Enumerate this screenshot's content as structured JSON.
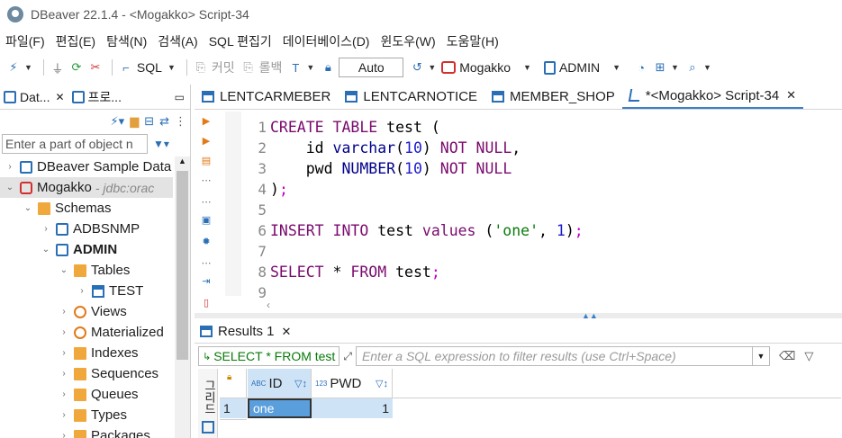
{
  "window": {
    "title": "DBeaver 22.1.4 - <Mogakko> Script-34"
  },
  "menu": [
    "파일(F)",
    "편집(E)",
    "탐색(N)",
    "검색(A)",
    "SQL 편집기",
    "데이터베이스(D)",
    "윈도우(W)",
    "도움말(H)"
  ],
  "toolbar": {
    "sql_label": "SQL",
    "commit_label": "커밋",
    "rollback_label": "롤백",
    "transaction_mode": "Auto",
    "datasource": "Mogakko",
    "schema": "ADMIN"
  },
  "navigator": {
    "tabs": [
      {
        "label": "Dat..."
      },
      {
        "label": "프로..."
      }
    ],
    "filter_placeholder": "Enter a part of object n",
    "tree": [
      {
        "label": "DBeaver Sample Data",
        "desc": "",
        "icon": "database-icon",
        "arrow": "›",
        "indent": 0
      },
      {
        "label": "Mogakko",
        "desc": "- jdbc:orac",
        "icon": "oracle-icon",
        "arrow": "⌄",
        "indent": 0,
        "selected": true
      },
      {
        "label": "Schemas",
        "desc": "",
        "icon": "folder-icon",
        "arrow": "⌄",
        "indent": 1
      },
      {
        "label": "ADBSNMP",
        "desc": "",
        "icon": "schema-icon",
        "arrow": "›",
        "indent": 2
      },
      {
        "label": "ADMIN",
        "desc": "",
        "icon": "schema-icon",
        "arrow": "⌄",
        "indent": 2,
        "bold": true
      },
      {
        "label": "Tables",
        "desc": "",
        "icon": "folder-icon",
        "arrow": "⌄",
        "indent": 3
      },
      {
        "label": "TEST",
        "desc": "",
        "icon": "table-icon",
        "arrow": "›",
        "indent": 4
      },
      {
        "label": "Views",
        "desc": "",
        "icon": "view-icon",
        "arrow": "›",
        "indent": 3
      },
      {
        "label": "Materialized",
        "desc": "",
        "icon": "view-icon",
        "arrow": "›",
        "indent": 3
      },
      {
        "label": "Indexes",
        "desc": "",
        "icon": "folder-icon",
        "arrow": "›",
        "indent": 3
      },
      {
        "label": "Sequences",
        "desc": "",
        "icon": "folder-icon",
        "arrow": "›",
        "indent": 3
      },
      {
        "label": "Queues",
        "desc": "",
        "icon": "folder-icon",
        "arrow": "›",
        "indent": 3
      },
      {
        "label": "Types",
        "desc": "",
        "icon": "folder-icon",
        "arrow": "›",
        "indent": 3
      },
      {
        "label": "Packages",
        "desc": "",
        "icon": "folder-icon",
        "arrow": "›",
        "indent": 3
      }
    ]
  },
  "editor_tabs": [
    {
      "label": "LENTCARMEBER",
      "active": false,
      "closable": false
    },
    {
      "label": "LENTCARNOTICE",
      "active": false,
      "closable": false
    },
    {
      "label": "MEMBER_SHOP",
      "active": false,
      "closable": false
    },
    {
      "label": "*<Mogakko> Script-34",
      "active": true,
      "closable": true
    }
  ],
  "editor": {
    "line_numbers": [
      "1",
      "2",
      "3",
      "4",
      "5",
      "6",
      "7",
      "8",
      "9"
    ],
    "lines": [
      [
        [
          "kw",
          "CREATE"
        ],
        [
          "p",
          " "
        ],
        [
          "kw",
          "TABLE"
        ],
        [
          "p",
          " test ("
        ]
      ],
      [
        [
          "p",
          "    id "
        ],
        [
          "ty",
          "varchar"
        ],
        [
          "p",
          "("
        ],
        [
          "num",
          "10"
        ],
        [
          "p",
          ") "
        ],
        [
          "kw",
          "NOT NULL"
        ],
        [
          "p",
          ","
        ]
      ],
      [
        [
          "p",
          "    pwd "
        ],
        [
          "ty",
          "NUMBER"
        ],
        [
          "p",
          "("
        ],
        [
          "num",
          "10"
        ],
        [
          "p",
          ") "
        ],
        [
          "kw",
          "NOT NULL"
        ]
      ],
      [
        [
          "p",
          ")"
        ],
        [
          "semi",
          ";"
        ]
      ],
      [
        [
          "p",
          ""
        ]
      ],
      [
        [
          "kw",
          "INSERT INTO"
        ],
        [
          "p",
          " test "
        ],
        [
          "kw",
          "values"
        ],
        [
          "p",
          " ("
        ],
        [
          "str",
          "'one'"
        ],
        [
          "p",
          ", "
        ],
        [
          "num",
          "1"
        ],
        [
          "p",
          ")"
        ],
        [
          "semi",
          ";"
        ]
      ],
      [
        [
          "p",
          ""
        ]
      ],
      [
        [
          "kw",
          "SELECT"
        ],
        [
          "p",
          " * "
        ],
        [
          "kw",
          "FROM"
        ],
        [
          "p",
          " test"
        ],
        [
          "semi",
          ";"
        ]
      ],
      [
        [
          "p",
          ""
        ]
      ]
    ]
  },
  "results": {
    "tab_label": "Results 1",
    "query_text": "SELECT * FROM test",
    "filter_placeholder": "Enter a SQL expression to filter results (use Ctrl+Space)",
    "side_label": "그리드",
    "columns": [
      {
        "name": "ID",
        "type": "ABC"
      },
      {
        "name": "PWD",
        "type": "123"
      }
    ],
    "rows": [
      {
        "num": "1",
        "cells": [
          "one",
          "1"
        ]
      }
    ]
  }
}
